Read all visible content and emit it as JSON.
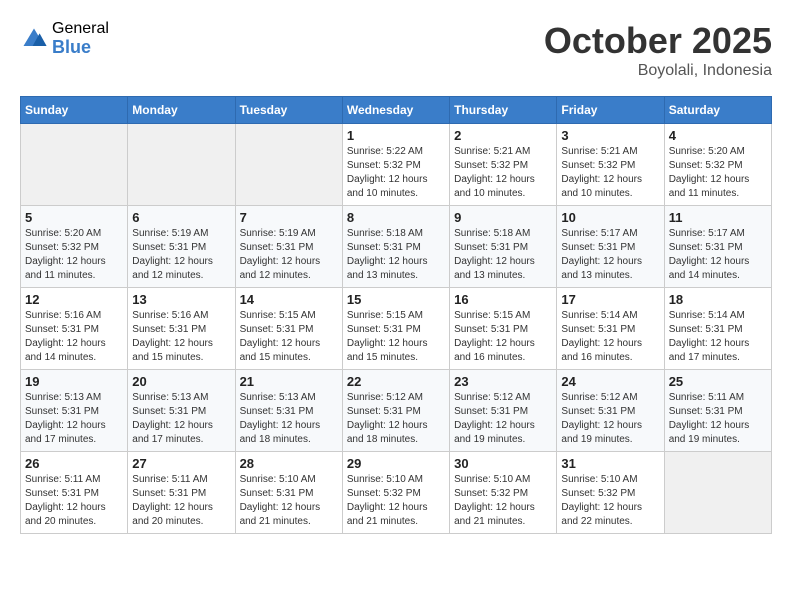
{
  "header": {
    "logo_general": "General",
    "logo_blue": "Blue",
    "month_year": "October 2025",
    "location": "Boyolali, Indonesia"
  },
  "calendar": {
    "days_of_week": [
      "Sunday",
      "Monday",
      "Tuesday",
      "Wednesday",
      "Thursday",
      "Friday",
      "Saturday"
    ],
    "weeks": [
      [
        {
          "day": "",
          "info": ""
        },
        {
          "day": "",
          "info": ""
        },
        {
          "day": "",
          "info": ""
        },
        {
          "day": "1",
          "info": "Sunrise: 5:22 AM\nSunset: 5:32 PM\nDaylight: 12 hours and 10 minutes."
        },
        {
          "day": "2",
          "info": "Sunrise: 5:21 AM\nSunset: 5:32 PM\nDaylight: 12 hours and 10 minutes."
        },
        {
          "day": "3",
          "info": "Sunrise: 5:21 AM\nSunset: 5:32 PM\nDaylight: 12 hours and 10 minutes."
        },
        {
          "day": "4",
          "info": "Sunrise: 5:20 AM\nSunset: 5:32 PM\nDaylight: 12 hours and 11 minutes."
        }
      ],
      [
        {
          "day": "5",
          "info": "Sunrise: 5:20 AM\nSunset: 5:32 PM\nDaylight: 12 hours and 11 minutes."
        },
        {
          "day": "6",
          "info": "Sunrise: 5:19 AM\nSunset: 5:31 PM\nDaylight: 12 hours and 12 minutes."
        },
        {
          "day": "7",
          "info": "Sunrise: 5:19 AM\nSunset: 5:31 PM\nDaylight: 12 hours and 12 minutes."
        },
        {
          "day": "8",
          "info": "Sunrise: 5:18 AM\nSunset: 5:31 PM\nDaylight: 12 hours and 13 minutes."
        },
        {
          "day": "9",
          "info": "Sunrise: 5:18 AM\nSunset: 5:31 PM\nDaylight: 12 hours and 13 minutes."
        },
        {
          "day": "10",
          "info": "Sunrise: 5:17 AM\nSunset: 5:31 PM\nDaylight: 12 hours and 13 minutes."
        },
        {
          "day": "11",
          "info": "Sunrise: 5:17 AM\nSunset: 5:31 PM\nDaylight: 12 hours and 14 minutes."
        }
      ],
      [
        {
          "day": "12",
          "info": "Sunrise: 5:16 AM\nSunset: 5:31 PM\nDaylight: 12 hours and 14 minutes."
        },
        {
          "day": "13",
          "info": "Sunrise: 5:16 AM\nSunset: 5:31 PM\nDaylight: 12 hours and 15 minutes."
        },
        {
          "day": "14",
          "info": "Sunrise: 5:15 AM\nSunset: 5:31 PM\nDaylight: 12 hours and 15 minutes."
        },
        {
          "day": "15",
          "info": "Sunrise: 5:15 AM\nSunset: 5:31 PM\nDaylight: 12 hours and 15 minutes."
        },
        {
          "day": "16",
          "info": "Sunrise: 5:15 AM\nSunset: 5:31 PM\nDaylight: 12 hours and 16 minutes."
        },
        {
          "day": "17",
          "info": "Sunrise: 5:14 AM\nSunset: 5:31 PM\nDaylight: 12 hours and 16 minutes."
        },
        {
          "day": "18",
          "info": "Sunrise: 5:14 AM\nSunset: 5:31 PM\nDaylight: 12 hours and 17 minutes."
        }
      ],
      [
        {
          "day": "19",
          "info": "Sunrise: 5:13 AM\nSunset: 5:31 PM\nDaylight: 12 hours and 17 minutes."
        },
        {
          "day": "20",
          "info": "Sunrise: 5:13 AM\nSunset: 5:31 PM\nDaylight: 12 hours and 17 minutes."
        },
        {
          "day": "21",
          "info": "Sunrise: 5:13 AM\nSunset: 5:31 PM\nDaylight: 12 hours and 18 minutes."
        },
        {
          "day": "22",
          "info": "Sunrise: 5:12 AM\nSunset: 5:31 PM\nDaylight: 12 hours and 18 minutes."
        },
        {
          "day": "23",
          "info": "Sunrise: 5:12 AM\nSunset: 5:31 PM\nDaylight: 12 hours and 19 minutes."
        },
        {
          "day": "24",
          "info": "Sunrise: 5:12 AM\nSunset: 5:31 PM\nDaylight: 12 hours and 19 minutes."
        },
        {
          "day": "25",
          "info": "Sunrise: 5:11 AM\nSunset: 5:31 PM\nDaylight: 12 hours and 19 minutes."
        }
      ],
      [
        {
          "day": "26",
          "info": "Sunrise: 5:11 AM\nSunset: 5:31 PM\nDaylight: 12 hours and 20 minutes."
        },
        {
          "day": "27",
          "info": "Sunrise: 5:11 AM\nSunset: 5:31 PM\nDaylight: 12 hours and 20 minutes."
        },
        {
          "day": "28",
          "info": "Sunrise: 5:10 AM\nSunset: 5:31 PM\nDaylight: 12 hours and 21 minutes."
        },
        {
          "day": "29",
          "info": "Sunrise: 5:10 AM\nSunset: 5:32 PM\nDaylight: 12 hours and 21 minutes."
        },
        {
          "day": "30",
          "info": "Sunrise: 5:10 AM\nSunset: 5:32 PM\nDaylight: 12 hours and 21 minutes."
        },
        {
          "day": "31",
          "info": "Sunrise: 5:10 AM\nSunset: 5:32 PM\nDaylight: 12 hours and 22 minutes."
        },
        {
          "day": "",
          "info": ""
        }
      ]
    ]
  }
}
